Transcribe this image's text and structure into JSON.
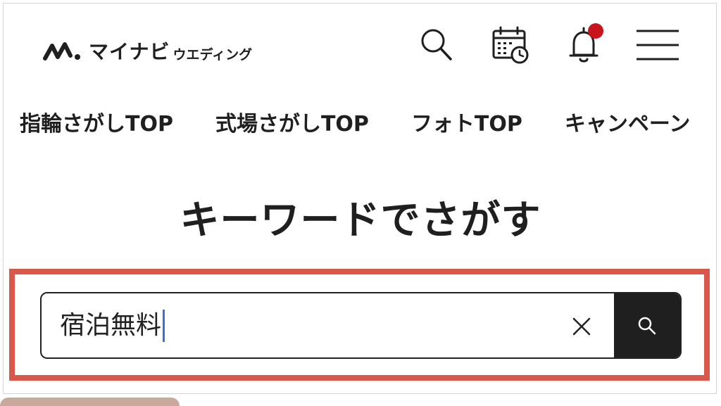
{
  "header": {
    "logo_main": "マイナビ",
    "logo_sub": "ウエディング",
    "icons": [
      "search-icon",
      "calendar-icon",
      "bell-icon",
      "menu-icon"
    ],
    "notification_color": "#c8151b"
  },
  "nav": {
    "items": [
      {
        "label": "指輪さがしTOP"
      },
      {
        "label": "式場さがしTOP"
      },
      {
        "label": "フォトTOP"
      },
      {
        "label": "キャンペーン"
      }
    ]
  },
  "section": {
    "title": "キーワードでさがす"
  },
  "search": {
    "value": "宿泊無料",
    "highlight_color": "#d9584b",
    "button_color": "#1f1f1f"
  }
}
